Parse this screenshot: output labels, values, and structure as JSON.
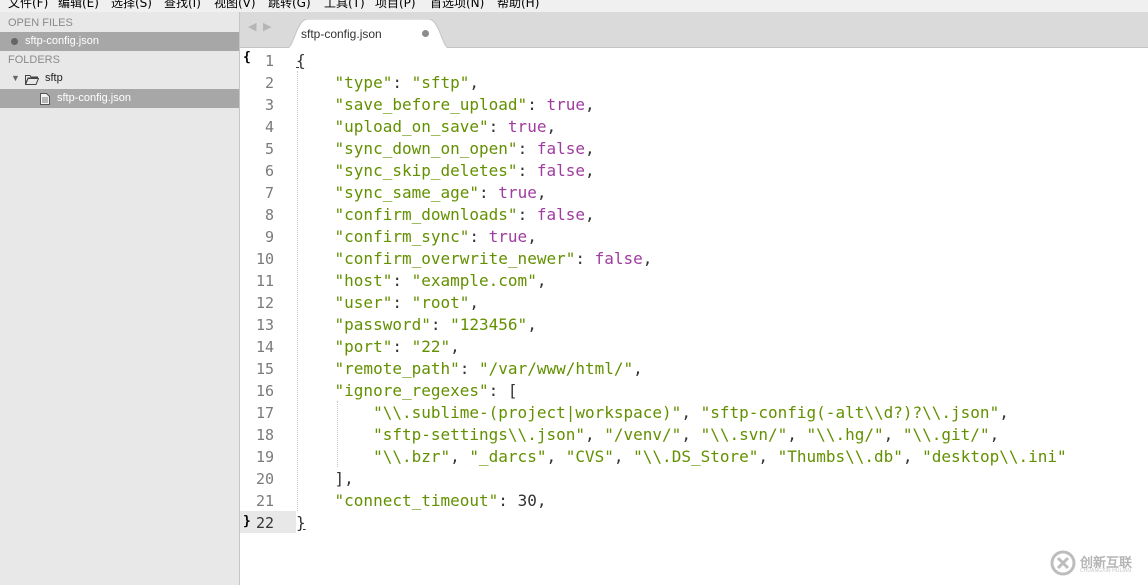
{
  "menu": {
    "items": [
      "文件(F)",
      "编辑(E)",
      "选择(S)",
      "查找(I)",
      "视图(V)",
      "跳转(G)",
      "工具(T)",
      "项目(P)",
      "首选项(N)",
      "帮助(H)"
    ]
  },
  "sidebar": {
    "open_files_header": "OPEN FILES",
    "open_file": "sftp-config.json",
    "folders_header": "FOLDERS",
    "folder_name": "sftp",
    "folder_file": "sftp-config.json"
  },
  "tab": {
    "title": "sftp-config.json"
  },
  "editor": {
    "current_line": 22,
    "line_numbers": [
      "1",
      "2",
      "3",
      "4",
      "5",
      "6",
      "7",
      "8",
      "9",
      "10",
      "11",
      "12",
      "13",
      "14",
      "15",
      "16",
      "17",
      "18",
      "19",
      "20",
      "21",
      "22"
    ],
    "lines": [
      "{",
      "    \"type\": \"sftp\",",
      "    \"save_before_upload\": true,",
      "    \"upload_on_save\": true,",
      "    \"sync_down_on_open\": false,",
      "    \"sync_skip_deletes\": false,",
      "    \"sync_same_age\": true,",
      "    \"confirm_downloads\": false,",
      "    \"confirm_sync\": true,",
      "    \"confirm_overwrite_newer\": false,",
      "    \"host\": \"example.com\",",
      "    \"user\": \"root\",",
      "    \"password\": \"123456\",",
      "    \"port\": \"22\",",
      "    \"remote_path\": \"/var/www/html/\",",
      "    \"ignore_regexes\": [",
      "        \"\\\\.sublime-(project|workspace)\", \"sftp-config(-alt\\\\d?)?\\\\.json\",",
      "        \"sftp-settings\\\\.json\", \"/venv/\", \"\\\\.svn/\", \"\\\\.hg/\", \"\\\\.git/\",",
      "        \"\\\\.bzr\", \"_darcs\", \"CVS\", \"\\\\.DS_Store\", \"Thumbs\\\\.db\", \"desktop\\\\.ini\"",
      "    ],",
      "    \"connect_timeout\": 30,",
      "}"
    ]
  },
  "watermark": {
    "text": "创新互联",
    "sub": "CHUANGXIN HULIAN"
  },
  "colors": {
    "string": "#639000",
    "boolean": "#a03ba0",
    "sidebar_bg": "#e8e8e8",
    "selected_row": "#a7a7a7"
  }
}
